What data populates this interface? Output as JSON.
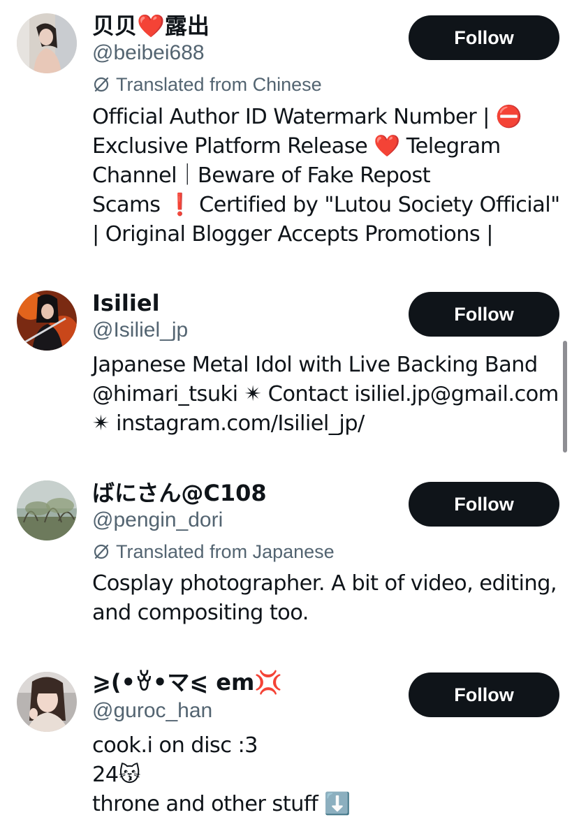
{
  "users": [
    {
      "display_name": "贝贝❤️露出",
      "handle": "@beibei688",
      "translated_label": "Translated from Chinese",
      "bio": "Official Author ID Watermark Number | ⛔\nExclusive Platform Release ❤️ Telegram\nChannel｜Beware of Fake Repost\nScams ❗ Certified by \"Lutou Society Official\"\n| Original Blogger Accepts Promotions |",
      "follow_label": "Follow"
    },
    {
      "display_name": "Isiliel",
      "handle": "@Isiliel_jp",
      "translated_label": "",
      "bio": "Japanese Metal Idol with Live Backing Band\n@himari_tsuki ✴ Contact isiliel.jp@gmail.com\n✴ instagram.com/Isiliel_jp/",
      "follow_label": "Follow"
    },
    {
      "display_name": "ばにさん@C108",
      "handle": "@pengin_dori",
      "translated_label": "Translated from Japanese",
      "bio": "Cosplay photographer. A bit of video, editing,\nand compositing too.",
      "follow_label": "Follow"
    },
    {
      "display_name": "⩾(•ꈊ•マ⩽ em💢",
      "handle": "@guroc_han",
      "translated_label": "",
      "bio": "cook.i on disc :3\n24😽\nthrone and other stuff ⬇️",
      "follow_label": "Follow"
    }
  ],
  "icons": {
    "translate": "translate-icon",
    "avatar": "avatar-image"
  },
  "colors": {
    "button_bg": "#0f1419",
    "button_text": "#ffffff",
    "secondary_text": "#536471",
    "primary_text": "#0f1419",
    "scrollbar": "#8e8e93"
  }
}
